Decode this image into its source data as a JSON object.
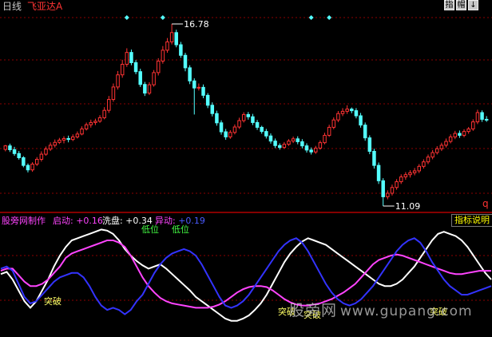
{
  "header": {
    "period_label": "日线",
    "formula_name": "飞亚达A",
    "buttons": [
      "指",
      "帽",
      "↓"
    ]
  },
  "price_panel": {
    "high_label": "16.78",
    "low_label": "11.09",
    "corner_mark": "q"
  },
  "indicator_panel": {
    "title": "股旁网制作",
    "params": [
      {
        "name": "启动:",
        "value": "+0.16",
        "color": "#ffffff",
        "value_color": "#ff44ff"
      },
      {
        "name": "洗盘:",
        "value": "+0.34",
        "color": "#ffffff",
        "value_color": "#ffffff"
      },
      {
        "name": "异动:",
        "value": "+0.19",
        "color": "#ff44ff",
        "value_color": "#4a5bff"
      }
    ],
    "help_button": "指标说明",
    "annotations": [
      {
        "text": "突破",
        "color": "#ffff66"
      },
      {
        "text": "低位",
        "color": "#44ff44"
      },
      {
        "text": "低位",
        "color": "#44ff44"
      },
      {
        "text": "突破",
        "color": "#ffff66"
      },
      {
        "text": "突破",
        "color": "#ffff66"
      },
      {
        "text": "突破",
        "color": "#ffff66"
      }
    ]
  },
  "watermark": {
    "text": "股旁网",
    "url": "www.gupang.com"
  },
  "colors": {
    "up": "#ff3333",
    "down": "#54ffff",
    "white_line": "#ffffff",
    "magenta_line": "#ff44ff",
    "blue_line": "#3333ff",
    "grid": "#8b0000"
  },
  "chart_data": {
    "type": "candlestick",
    "title": "",
    "candles": [
      [
        12.86,
        12.97,
        12.8,
        13.0
      ],
      [
        12.97,
        12.85,
        12.78,
        13.04
      ],
      [
        12.85,
        12.73,
        12.66,
        12.94
      ],
      [
        12.73,
        12.6,
        12.54,
        12.81
      ],
      [
        12.6,
        12.36,
        12.3,
        12.65
      ],
      [
        12.36,
        12.22,
        12.14,
        12.42
      ],
      [
        12.22,
        12.4,
        12.16,
        12.46
      ],
      [
        12.4,
        12.55,
        12.34,
        12.62
      ],
      [
        12.55,
        12.71,
        12.48,
        12.8
      ],
      [
        12.71,
        12.87,
        12.66,
        12.95
      ],
      [
        12.87,
        12.99,
        12.81,
        13.08
      ],
      [
        12.99,
        13.08,
        12.92,
        13.17
      ],
      [
        13.08,
        13.15,
        13.03,
        13.22
      ],
      [
        13.15,
        13.2,
        13.05,
        13.27
      ],
      [
        13.2,
        13.17,
        13.08,
        13.29
      ],
      [
        13.17,
        13.25,
        13.12,
        13.33
      ],
      [
        13.25,
        13.34,
        13.2,
        13.42
      ],
      [
        13.34,
        13.5,
        13.3,
        13.58
      ],
      [
        13.5,
        13.63,
        13.45,
        13.7
      ],
      [
        13.63,
        13.7,
        13.54,
        13.79
      ],
      [
        13.7,
        13.74,
        13.62,
        13.82
      ],
      [
        13.74,
        13.85,
        13.69,
        13.93
      ],
      [
        13.85,
        14.08,
        13.8,
        14.18
      ],
      [
        14.08,
        14.42,
        14.0,
        14.53
      ],
      [
        14.42,
        14.81,
        14.35,
        14.92
      ],
      [
        14.81,
        15.19,
        14.73,
        15.31
      ],
      [
        15.19,
        15.52,
        15.1,
        15.66
      ],
      [
        15.52,
        15.89,
        15.44,
        16.02
      ],
      [
        15.89,
        15.57,
        15.49,
        15.98
      ],
      [
        15.57,
        15.29,
        15.21,
        15.65
      ],
      [
        15.29,
        14.89,
        14.81,
        15.38
      ],
      [
        14.89,
        14.62,
        14.53,
        14.97
      ],
      [
        14.62,
        14.88,
        14.56,
        14.96
      ],
      [
        14.88,
        15.26,
        14.82,
        15.34
      ],
      [
        15.26,
        15.62,
        15.17,
        15.71
      ],
      [
        15.62,
        15.96,
        15.54,
        16.09
      ],
      [
        15.96,
        16.22,
        15.88,
        16.34
      ],
      [
        16.22,
        16.51,
        16.14,
        16.78
      ],
      [
        16.51,
        16.13,
        16.05,
        16.6
      ],
      [
        16.13,
        15.8,
        15.72,
        16.22
      ],
      [
        15.8,
        15.41,
        15.3,
        15.88
      ],
      [
        15.41,
        15.0,
        14.9,
        15.49
      ],
      [
        15.0,
        14.78,
        13.95,
        15.08
      ],
      [
        14.78,
        14.8,
        14.7,
        14.92
      ],
      [
        14.8,
        14.55,
        14.46,
        14.89
      ],
      [
        14.55,
        14.24,
        14.15,
        14.62
      ],
      [
        14.24,
        13.98,
        13.89,
        14.33
      ],
      [
        13.98,
        13.69,
        13.6,
        14.07
      ],
      [
        13.69,
        13.41,
        13.32,
        13.77
      ],
      [
        13.41,
        13.25,
        13.16,
        13.5
      ],
      [
        13.25,
        13.39,
        13.19,
        13.46
      ],
      [
        13.39,
        13.56,
        13.33,
        13.64
      ],
      [
        13.56,
        13.76,
        13.5,
        13.85
      ],
      [
        13.76,
        13.95,
        13.7,
        14.02
      ],
      [
        13.95,
        13.88,
        13.79,
        14.03
      ],
      [
        13.88,
        13.7,
        13.62,
        13.97
      ],
      [
        13.7,
        13.55,
        13.47,
        13.78
      ],
      [
        13.55,
        13.42,
        13.35,
        13.6
      ],
      [
        13.42,
        13.28,
        13.2,
        13.5
      ],
      [
        13.28,
        13.12,
        13.04,
        13.36
      ],
      [
        13.12,
        12.98,
        12.9,
        13.2
      ],
      [
        12.98,
        12.92,
        12.85,
        13.05
      ],
      [
        12.92,
        13.02,
        12.88,
        13.09
      ],
      [
        13.02,
        13.12,
        12.97,
        13.18
      ],
      [
        13.12,
        13.19,
        13.06,
        13.26
      ],
      [
        13.19,
        13.1,
        13.02,
        13.27
      ],
      [
        13.1,
        12.97,
        12.89,
        13.18
      ],
      [
        12.97,
        12.84,
        12.76,
        13.05
      ],
      [
        12.84,
        12.78,
        12.7,
        12.92
      ],
      [
        12.78,
        12.9,
        12.72,
        12.97
      ],
      [
        12.9,
        13.07,
        12.85,
        13.14
      ],
      [
        13.07,
        13.3,
        13.02,
        13.38
      ],
      [
        13.3,
        13.55,
        13.25,
        13.63
      ],
      [
        13.55,
        13.78,
        13.49,
        13.86
      ],
      [
        13.78,
        13.98,
        13.71,
        14.06
      ],
      [
        13.98,
        14.05,
        13.9,
        14.15
      ],
      [
        14.05,
        14.12,
        13.97,
        14.24
      ],
      [
        14.12,
        14.07,
        13.99,
        14.17
      ],
      [
        14.07,
        13.91,
        13.83,
        14.15
      ],
      [
        13.91,
        13.62,
        13.54,
        14.0
      ],
      [
        13.62,
        13.22,
        13.13,
        13.7
      ],
      [
        13.22,
        12.8,
        12.71,
        13.3
      ],
      [
        12.8,
        12.36,
        12.26,
        12.88
      ],
      [
        12.36,
        11.88,
        11.78,
        12.45
      ],
      [
        11.88,
        11.38,
        11.09,
        11.96
      ],
      [
        11.38,
        11.49,
        11.3,
        11.58
      ],
      [
        11.49,
        11.67,
        11.42,
        11.76
      ],
      [
        11.67,
        11.85,
        11.6,
        11.93
      ],
      [
        11.85,
        12.0,
        11.78,
        12.08
      ],
      [
        12.0,
        12.07,
        11.91,
        12.15
      ],
      [
        12.07,
        12.13,
        11.98,
        12.21
      ],
      [
        12.13,
        12.19,
        12.05,
        12.28
      ],
      [
        12.19,
        12.33,
        12.12,
        12.4
      ],
      [
        12.33,
        12.47,
        12.26,
        12.55
      ],
      [
        12.47,
        12.62,
        12.4,
        12.7
      ],
      [
        12.62,
        12.76,
        12.55,
        12.84
      ],
      [
        12.76,
        12.88,
        12.7,
        12.96
      ],
      [
        12.88,
        12.99,
        12.81,
        13.07
      ],
      [
        12.99,
        13.11,
        12.92,
        13.2
      ],
      [
        13.11,
        13.25,
        13.05,
        13.33
      ],
      [
        13.25,
        13.36,
        13.18,
        13.44
      ],
      [
        13.36,
        13.3,
        13.22,
        13.45
      ],
      [
        13.3,
        13.42,
        13.24,
        13.49
      ],
      [
        13.42,
        13.5,
        13.35,
        13.56
      ],
      [
        13.5,
        13.72,
        13.44,
        13.8
      ],
      [
        13.72,
        14.01,
        13.65,
        14.1
      ],
      [
        14.01,
        13.8,
        13.72,
        14.08
      ],
      [
        13.8,
        13.78,
        13.72,
        13.9
      ]
    ],
    "indicator_series": [
      {
        "name": "white",
        "values": [
          55,
          57,
          50,
          40,
          30,
          24,
          30,
          40,
          50,
          62,
          72,
          80,
          86,
          88,
          90,
          92,
          94,
          96,
          95,
          92,
          86,
          78,
          72,
          67,
          63,
          60,
          62,
          64,
          60,
          55,
          50,
          45,
          40,
          34,
          30,
          26,
          22,
          18,
          14,
          12,
          12,
          14,
          17,
          22,
          28,
          36,
          46,
          56,
          66,
          74,
          80,
          85,
          88,
          86,
          84,
          82,
          78,
          74,
          70,
          66,
          62,
          58,
          54,
          50,
          46,
          44,
          44,
          46,
          50,
          56,
          62,
          70,
          78,
          86,
          92,
          94,
          92,
          90,
          86,
          80,
          72,
          64,
          56,
          50
        ]
      },
      {
        "name": "magenta",
        "values": [
          58,
          60,
          60,
          54,
          48,
          44,
          44,
          46,
          50,
          56,
          62,
          70,
          74,
          76,
          78,
          80,
          82,
          84,
          86,
          86,
          84,
          80,
          72,
          62,
          52,
          44,
          38,
          33,
          30,
          28,
          27,
          26,
          25,
          24,
          24,
          24,
          25,
          27,
          30,
          34,
          38,
          41,
          43,
          44,
          44,
          43,
          40,
          36,
          32,
          29,
          27,
          26,
          26,
          27,
          28,
          30,
          32,
          35,
          38,
          42,
          46,
          52,
          58,
          64,
          68,
          70,
          72,
          73,
          72,
          70,
          68,
          66,
          64,
          62,
          60,
          58,
          56,
          55,
          55,
          56,
          57,
          58,
          58,
          58
        ]
      },
      {
        "name": "blue",
        "values": [
          60,
          62,
          58,
          46,
          34,
          28,
          30,
          36,
          42,
          48,
          52,
          54,
          56,
          56,
          52,
          44,
          34,
          26,
          22,
          24,
          22,
          18,
          22,
          30,
          36,
          46,
          56,
          64,
          70,
          74,
          76,
          78,
          76,
          72,
          64,
          54,
          44,
          34,
          26,
          24,
          26,
          30,
          36,
          44,
          52,
          60,
          68,
          76,
          82,
          86,
          88,
          84,
          76,
          66,
          56,
          46,
          38,
          32,
          28,
          26,
          28,
          32,
          38,
          44,
          52,
          60,
          68,
          76,
          82,
          86,
          88,
          84,
          76,
          66,
          58,
          50,
          44,
          40,
          36,
          36,
          38,
          40,
          42,
          44
        ]
      }
    ]
  }
}
